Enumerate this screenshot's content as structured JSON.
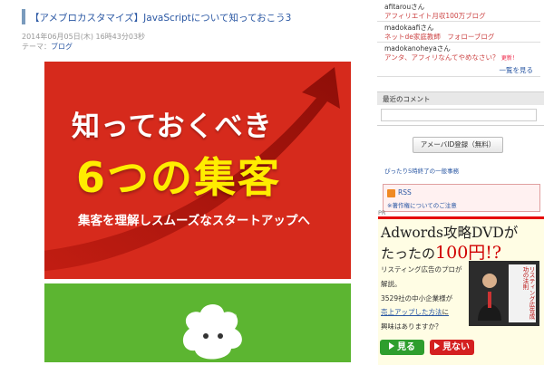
{
  "article": {
    "title": "【アメブロカスタマイズ】JavaScriptについて知っておこう3",
    "date": "2014年06月05日(木) 16時43分03秒",
    "theme_label": "テーマ：",
    "theme_link": "ブログ",
    "banner": {
      "line1": "知っておくべき",
      "line2": "6つの集客",
      "line3": "集客を理解しスムーズなスタートアップへ",
      "registered_mark": "®"
    }
  },
  "sidebar": {
    "readers": [
      {
        "name": "afitarouさん",
        "blog": "アフィリエイト月収100万ブログ"
      },
      {
        "name": "madokaafiさん",
        "blog": "ネットde家庭教師　フォローブログ"
      },
      {
        "name": "madokanoheyaさん",
        "blog": "アンタ、アフィリなんてやめなさい？",
        "badge": "更新！"
      }
    ],
    "more_link": "一覧を見る",
    "recent_comments_header": "最近のコメント",
    "register_button": "アメーバID登録（無料）",
    "small_link": "ぴったり5時終了の一般事務",
    "rss_label": "RSS",
    "copyright_note": "※著作権についてのご注意",
    "pr_label": "PR"
  },
  "ad": {
    "line1": "Adwords攻略DVDが",
    "line2_prefix": "たったの",
    "line2_price": "100円",
    "line2_suffix": "!?",
    "text1": "リスティング広告のプロが",
    "text2": "解説。",
    "text3": "3529社の中小企業様が",
    "underline": "売上アップした方法",
    "text4": "に",
    "text5": "興味はありますか？",
    "book_title": "リスティング広告成功の法則",
    "btn_yes": "見る",
    "btn_no": "見ない"
  },
  "colors": {
    "banner_red": "#d62a1c",
    "banner_yellow": "#ffed00",
    "green_panel": "#5cb531",
    "link_blue": "#2a57a3"
  }
}
